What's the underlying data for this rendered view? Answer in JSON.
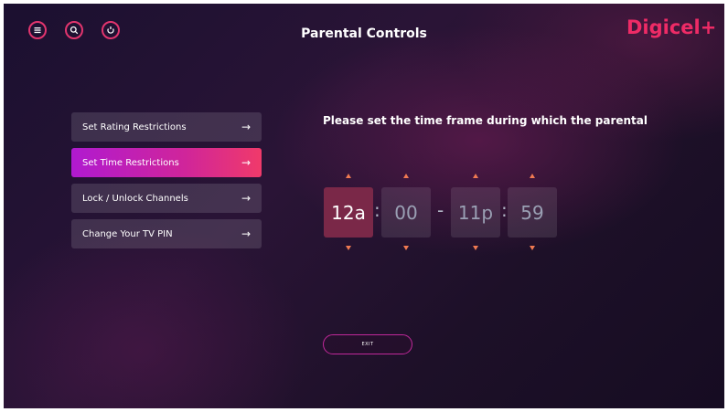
{
  "header": {
    "title": "Parental Controls",
    "logo_text": "Digicel+",
    "icons": [
      "menu-icon",
      "search-icon",
      "profile-icon"
    ],
    "accent_color": "#e2356e"
  },
  "menu": {
    "items": [
      {
        "label": "Set Rating Restrictions"
      },
      {
        "label": "Set Time Restrictions"
      },
      {
        "label": "Lock / Unlock Channels"
      },
      {
        "label": "Change Your TV PIN"
      }
    ],
    "arrow": "→",
    "selected_index": 1
  },
  "time_restriction": {
    "prompt": "Please set the time frame during which the parental",
    "start_hour": "12a",
    "start_minute": "00",
    "end_hour": "11p",
    "end_minute": "59",
    "colon": ":",
    "dash": "-"
  },
  "exit_button": {
    "label": "EXIT"
  }
}
